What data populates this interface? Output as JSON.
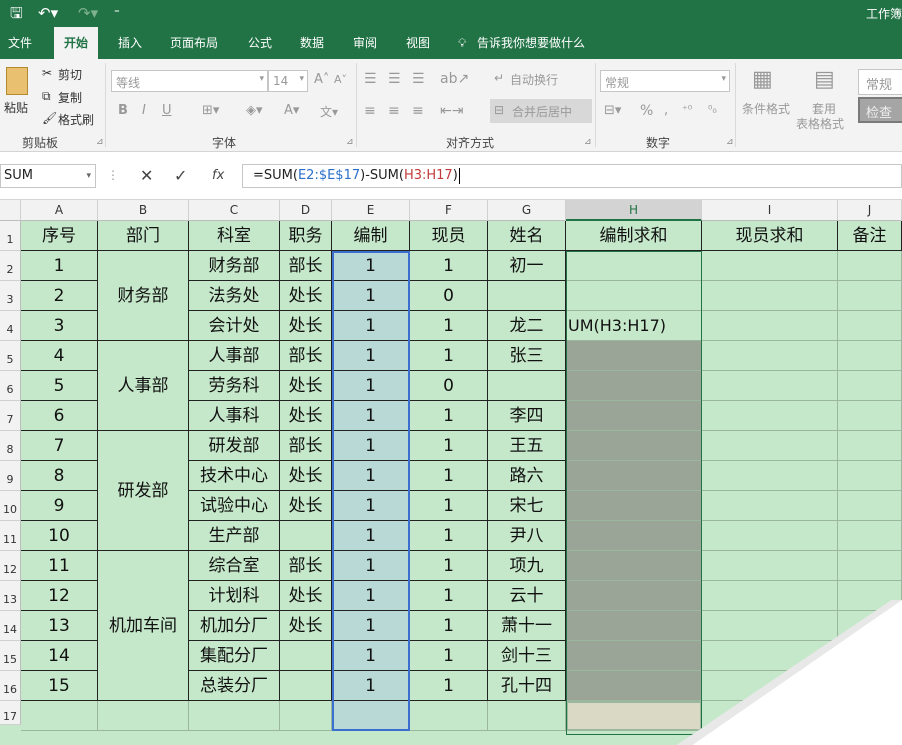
{
  "titlebar": {
    "title": "工作簿"
  },
  "tabs": [
    "文件",
    "开始",
    "插入",
    "页面布局",
    "公式",
    "数据",
    "审阅",
    "视图",
    "告诉我你想要做什么"
  ],
  "ribbon": {
    "clipboard": {
      "paste": "粘贴",
      "cut": "剪切",
      "copy": "复制",
      "format_painter": "格式刷",
      "group": "剪贴板"
    },
    "font": {
      "font_name": "等线",
      "font_size": "14",
      "bold": "B",
      "italic": "I",
      "underline": "U",
      "group": "字体"
    },
    "alignment": {
      "wrap": "自动换行",
      "merge": "合并后居中",
      "group": "对齐方式"
    },
    "number": {
      "format": "常规",
      "percent": "%",
      "group": "数字"
    },
    "styles": {
      "conditional": "条件格式",
      "table_format_1": "套用",
      "table_format_2": "表格格式",
      "style_normal": "常规",
      "style_check": "检查"
    }
  },
  "formula_bar": {
    "name_box": "SUM",
    "fx": "fx",
    "formula": {
      "pre": "=SUM(",
      "ref1": "E2:$E$17",
      "mid": ")-SUM(",
      "ref2": "H3:H17",
      "post": ")"
    }
  },
  "columns": [
    "A",
    "B",
    "C",
    "D",
    "E",
    "F",
    "G",
    "H",
    "I",
    "J"
  ],
  "rows": [
    "1",
    "2",
    "3",
    "4",
    "5",
    "6",
    "7",
    "8",
    "9",
    "10",
    "11",
    "12",
    "13",
    "14",
    "15",
    "16",
    "17"
  ],
  "sheet": {
    "headers": [
      "序号",
      "部门",
      "科室",
      "职务",
      "编制",
      "现员",
      "姓名",
      "编制求和",
      "现员求和",
      "备注"
    ],
    "data": [
      [
        "1",
        "财务部",
        "部长",
        "1",
        "1",
        "初一"
      ],
      [
        "2",
        "法务处",
        "处长",
        "1",
        "0",
        ""
      ],
      [
        "3",
        "会计处",
        "处长",
        "1",
        "1",
        "龙二"
      ],
      [
        "4",
        "人事部",
        "部长",
        "1",
        "1",
        "张三"
      ],
      [
        "5",
        "劳务科",
        "处长",
        "1",
        "0",
        ""
      ],
      [
        "6",
        "人事科",
        "处长",
        "1",
        "1",
        "李四"
      ],
      [
        "7",
        "研发部",
        "部长",
        "1",
        "1",
        "王五"
      ],
      [
        "8",
        "技术中心",
        "处长",
        "1",
        "1",
        "路六"
      ],
      [
        "9",
        "试验中心",
        "处长",
        "1",
        "1",
        "宋七"
      ],
      [
        "10",
        "生产部",
        "",
        "1",
        "1",
        "尹八"
      ],
      [
        "11",
        "综合室",
        "部长",
        "1",
        "1",
        "项九"
      ],
      [
        "12",
        "计划科",
        "处长",
        "1",
        "1",
        "云十"
      ],
      [
        "13",
        "机加分厂",
        "处长",
        "1",
        "1",
        "萧十一"
      ],
      [
        "14",
        "集配分厂",
        "",
        "1",
        "1",
        "剑十三"
      ],
      [
        "15",
        "总装分厂",
        "",
        "1",
        "1",
        "孔十四"
      ]
    ],
    "departments": [
      "财务部",
      "人事部",
      "研发部",
      "机加车间"
    ],
    "h_overflow_text": "UM(H3:H17)"
  }
}
